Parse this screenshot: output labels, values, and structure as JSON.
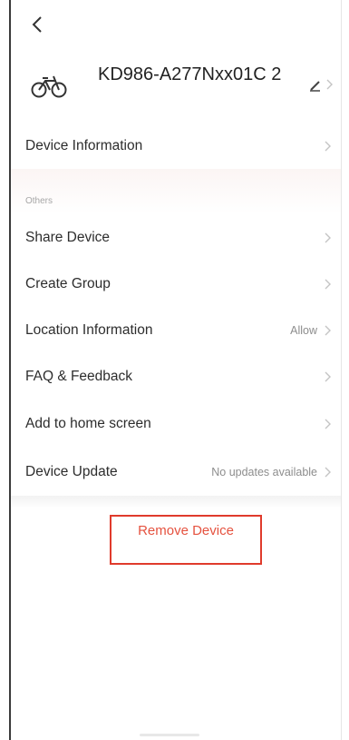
{
  "device": {
    "name": "KD986-A277Nxx01C 2"
  },
  "info_row": {
    "label": "Device Information"
  },
  "section": {
    "title": "Others"
  },
  "rows": [
    {
      "label": "Share Device",
      "value": ""
    },
    {
      "label": "Create Group",
      "value": ""
    },
    {
      "label": "Location Information",
      "value": "Allow"
    },
    {
      "label": "FAQ & Feedback",
      "value": ""
    },
    {
      "label": "Add to home screen",
      "value": ""
    },
    {
      "label": "Device Update",
      "value": "No updates available"
    }
  ],
  "remove": {
    "label": "Remove Device"
  },
  "colors": {
    "accent_red": "#e5523f",
    "outline_red": "#e03b2c",
    "chevron": "#c4c4c4"
  },
  "icons": [
    "back-arrow-icon",
    "bicycle-icon",
    "edit-pencil-icon",
    "chevron-right-icon"
  ]
}
